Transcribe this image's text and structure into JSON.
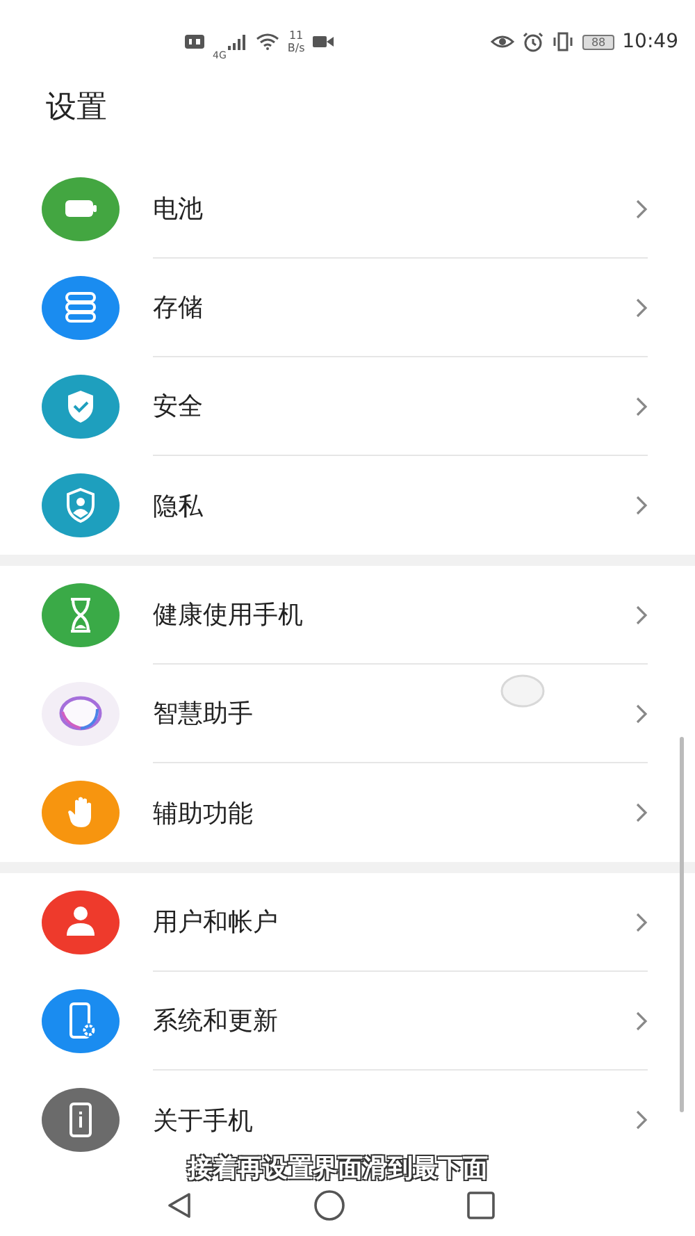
{
  "status_bar": {
    "network": "4G",
    "speed_value": "11",
    "speed_unit": "B/s",
    "battery": "88",
    "time": "10:49"
  },
  "title": "设置",
  "groups": [
    {
      "items": [
        {
          "kind": "battery",
          "label": "电池"
        },
        {
          "kind": "storage",
          "label": "存储"
        },
        {
          "kind": "security",
          "label": "安全"
        },
        {
          "kind": "privacy",
          "label": "隐私"
        }
      ]
    },
    {
      "items": [
        {
          "kind": "hourglass",
          "label": "健康使用手机"
        },
        {
          "kind": "assistant",
          "label": "智慧助手"
        },
        {
          "kind": "hand",
          "label": "辅助功能"
        }
      ]
    },
    {
      "items": [
        {
          "kind": "user",
          "label": "用户和帐户"
        },
        {
          "kind": "system",
          "label": "系统和更新"
        },
        {
          "kind": "about",
          "label": "关于手机"
        }
      ]
    }
  ],
  "caption": "接着再设置界面滑到最下面"
}
